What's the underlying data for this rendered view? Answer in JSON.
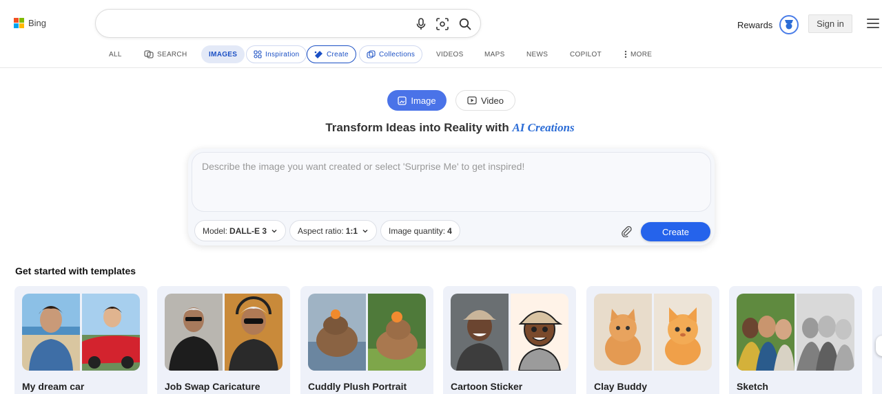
{
  "header": {
    "logo_text": "Bing",
    "search": {
      "value": "",
      "placeholder": ""
    },
    "rewards_label": "Rewards",
    "signin_label": "Sign in"
  },
  "nav": {
    "items": [
      {
        "label": "ALL"
      },
      {
        "label": "SEARCH",
        "icon": "copilot-icon"
      },
      {
        "label": "IMAGES"
      },
      {
        "label": "Inspiration",
        "icon": "inspiration-icon"
      },
      {
        "label": "Create",
        "icon": "create-icon"
      },
      {
        "label": "Collections",
        "icon": "collections-icon"
      },
      {
        "label": "VIDEOS"
      },
      {
        "label": "MAPS"
      },
      {
        "label": "NEWS"
      },
      {
        "label": "COPILOT"
      },
      {
        "label": "MORE",
        "icon": "more-dots-icon"
      }
    ]
  },
  "mode_toggle": {
    "image_label": "Image",
    "video_label": "Video",
    "selected": "Image"
  },
  "headline": {
    "prefix": "Transform Ideas into Reality with ",
    "highlight": "AI Creations"
  },
  "creator": {
    "prompt_placeholder": "Describe the image you want created or select 'Surprise Me' to get inspired!",
    "prompt_value": "",
    "model_label": "Model:",
    "model_value": "DALL-E 3",
    "aspect_label": "Aspect ratio:",
    "aspect_value": "1:1",
    "quantity_label": "Image quantity:",
    "quantity_value": "4",
    "create_label": "Create"
  },
  "templates": {
    "title": "Get started with templates",
    "items": [
      {
        "label": "My dream car"
      },
      {
        "label": "Job Swap Caricature"
      },
      {
        "label": "Cuddly Plush Portrait"
      },
      {
        "label": "Cartoon Sticker"
      },
      {
        "label": "Clay Buddy"
      },
      {
        "label": "Sketch"
      }
    ]
  },
  "colors": {
    "accent": "#2563eb",
    "toggle_active": "#4a73e8",
    "headline_highlight": "#2b6cd6",
    "card_bg": "#eef1f9"
  }
}
